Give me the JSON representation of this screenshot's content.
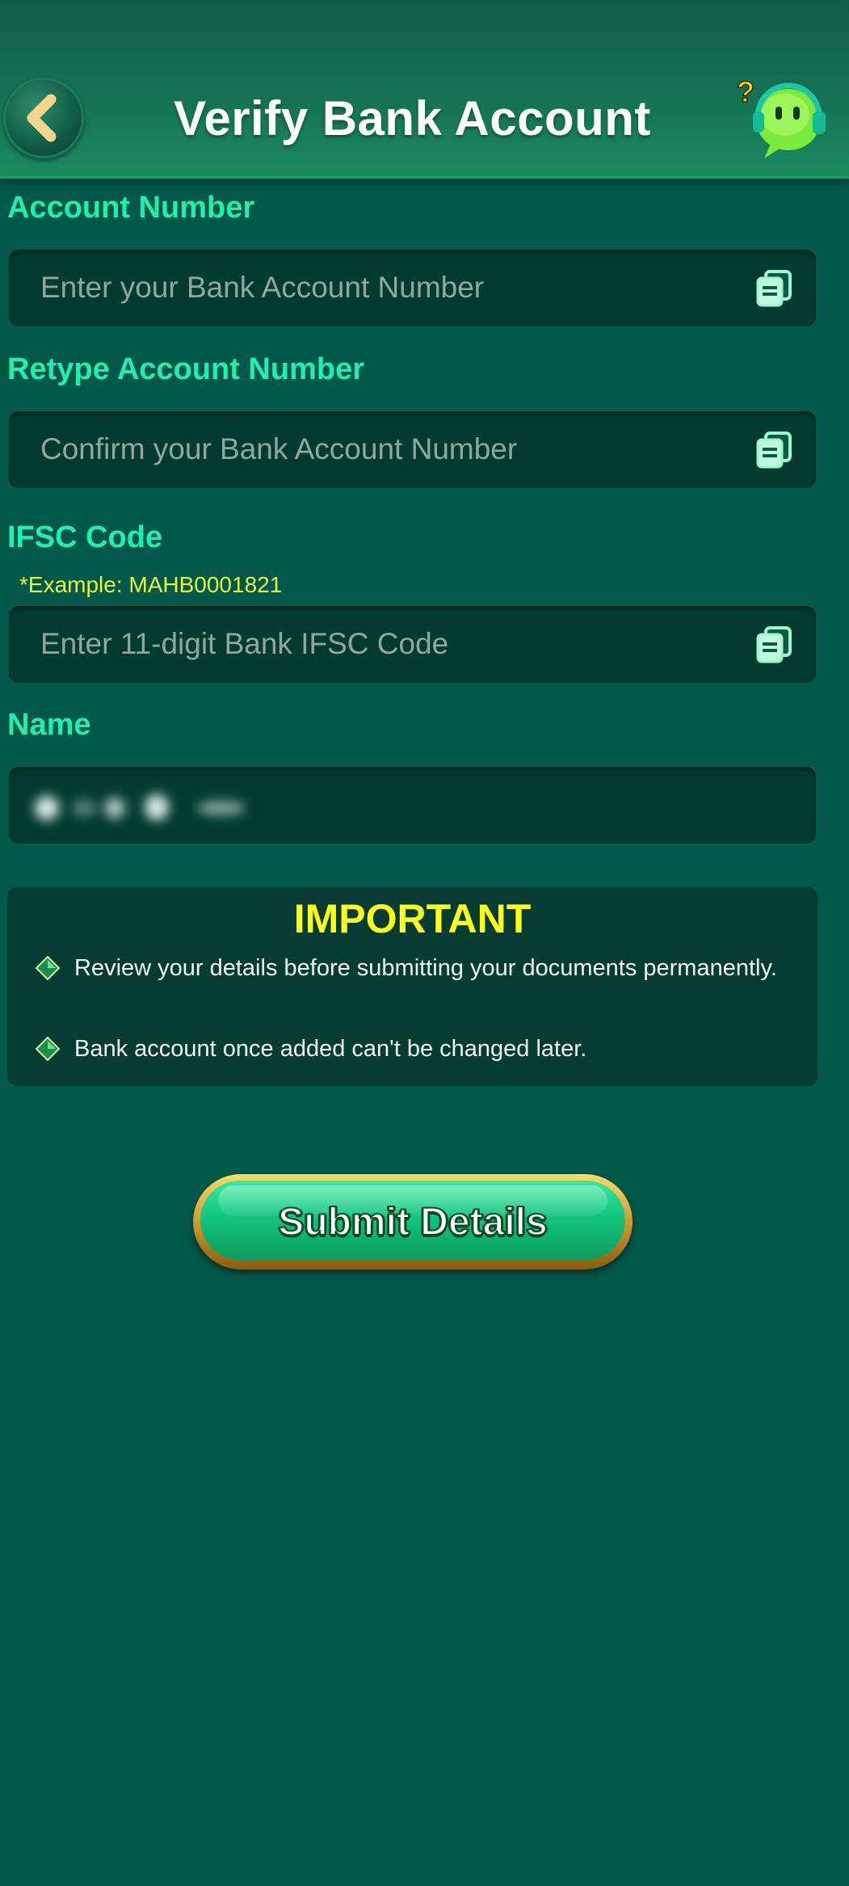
{
  "header": {
    "title": "Verify Bank Account",
    "back_icon": "chevron-left-icon",
    "support_icon": "headset-support-icon"
  },
  "form": {
    "account_number": {
      "label": "Account Number",
      "placeholder": "Enter your Bank Account Number",
      "icon": "copy-icon"
    },
    "retype_account_number": {
      "label": "Retype Account Number",
      "placeholder": "Confirm your Bank Account Number",
      "icon": "copy-icon"
    },
    "ifsc": {
      "label": "IFSC Code",
      "example": "*Example: MAHB0001821",
      "placeholder": "Enter 11-digit Bank IFSC Code",
      "icon": "copy-icon"
    },
    "name": {
      "label": "Name",
      "value_blurred": true
    }
  },
  "important": {
    "title": "IMPORTANT",
    "items": [
      "Review your details before submitting your documents permanently.",
      "Bank account once added can't be changed later."
    ]
  },
  "submit": {
    "label": "Submit Details"
  },
  "colors": {
    "background": "#02584a",
    "label": "#1ff0ad",
    "example": "#e5f53a",
    "important_title": "#ffff1a",
    "input_bg": "#033b31",
    "button_green": "#14c47f",
    "button_border_gold": "#c9962a"
  }
}
